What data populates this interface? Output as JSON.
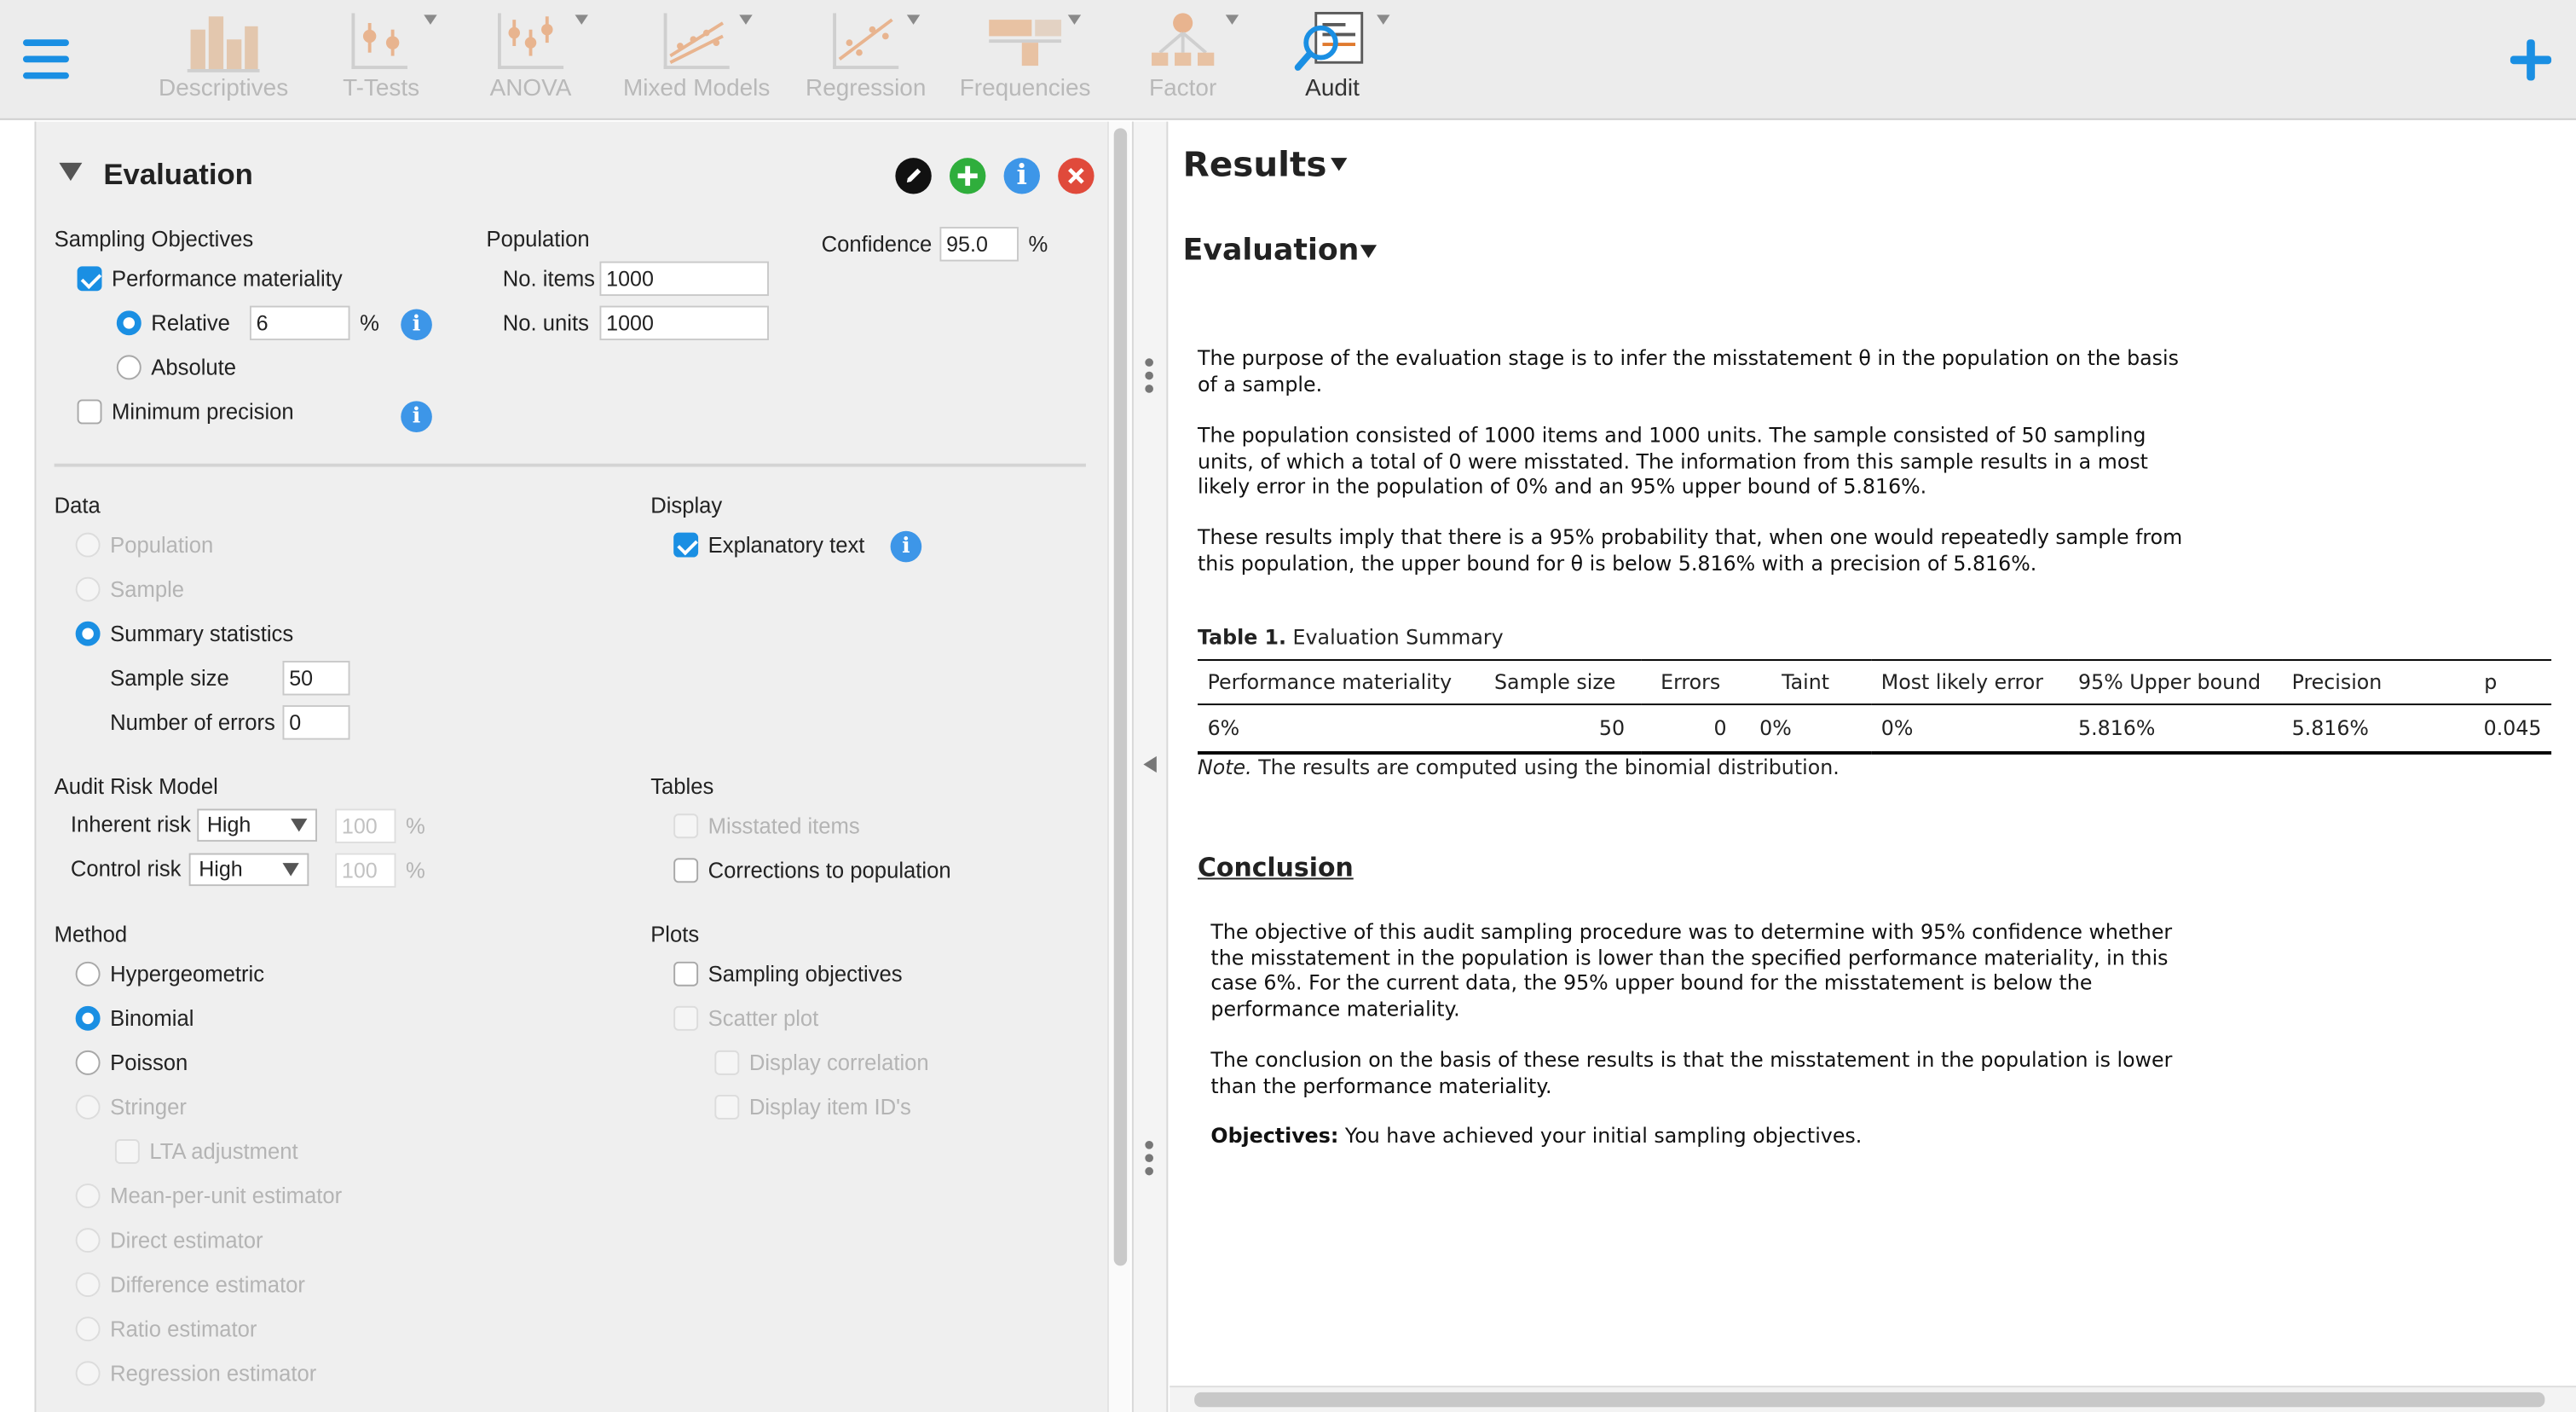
{
  "ribbon": {
    "items": [
      {
        "label": "Descriptives",
        "active": false
      },
      {
        "label": "T-Tests",
        "active": false
      },
      {
        "label": "ANOVA",
        "active": false
      },
      {
        "label": "Mixed Models",
        "active": false
      },
      {
        "label": "Regression",
        "active": false
      },
      {
        "label": "Frequencies",
        "active": false
      },
      {
        "label": "Factor",
        "active": false
      },
      {
        "label": "Audit",
        "active": true
      }
    ]
  },
  "panel": {
    "title": "Evaluation",
    "sampling_objectives": {
      "header": "Sampling Objectives",
      "performance_materiality": "Performance materiality",
      "relative": "Relative",
      "relative_value": "6",
      "percent": "%",
      "absolute": "Absolute",
      "minimum_precision": "Minimum precision"
    },
    "population": {
      "header": "Population",
      "items_label": "No. items",
      "items_value": "1000",
      "units_label": "No. units",
      "units_value": "1000"
    },
    "confidence": {
      "label": "Confidence",
      "value": "95.0",
      "percent": "%"
    },
    "data": {
      "header": "Data",
      "population": "Population",
      "sample": "Sample",
      "summary": "Summary statistics",
      "sample_size_label": "Sample size",
      "sample_size_value": "50",
      "errors_label": "Number of errors",
      "errors_value": "0"
    },
    "display": {
      "header": "Display",
      "explanatory": "Explanatory text"
    },
    "audit_risk": {
      "header": "Audit Risk Model",
      "inherent_label": "Inherent risk",
      "inherent_value": "High",
      "inherent_pct": "100",
      "control_label": "Control risk",
      "control_value": "High",
      "control_pct": "100",
      "percent": "%"
    },
    "tables": {
      "header": "Tables",
      "misstated": "Misstated items",
      "corrections": "Corrections to population"
    },
    "method": {
      "header": "Method",
      "hypergeometric": "Hypergeometric",
      "binomial": "Binomial",
      "poisson": "Poisson",
      "stringer": "Stringer",
      "lta": "LTA adjustment",
      "mpu": "Mean-per-unit estimator",
      "direct": "Direct estimator",
      "difference": "Difference estimator",
      "ratio": "Ratio estimator",
      "regression": "Regression estimator"
    },
    "plots": {
      "header": "Plots",
      "sampling_objectives": "Sampling objectives",
      "scatter": "Scatter plot",
      "correlation": "Display correlation",
      "item_ids": "Display item ID's"
    }
  },
  "results": {
    "title": "Results",
    "section": "Evaluation",
    "p1": "The purpose of the evaluation stage is to infer the misstatement θ in the population on the basis of a sample.",
    "p2": "The population consisted of 1000 items and 1000 units. The sample consisted of 50 sampling units, of which a total of 0 were misstated. The information from this sample results in a most likely error in the population of 0% and an 95% upper bound of 5.816%.",
    "p3": "These results imply that there is a 95% probability that, when one would repeatedly sample from this population, the upper bound for θ is below 5.816% with a precision of 5.816%.",
    "table_caption_bold": "Table 1.",
    "table_caption": " Evaluation Summary",
    "table": {
      "headers": [
        "Performance materiality",
        "Sample size",
        "Errors",
        "Taint",
        "Most likely error",
        "95% Upper bound",
        "Precision",
        "p"
      ],
      "row": [
        "6%",
        "50",
        "0",
        "0%",
        "0%",
        "5.816%",
        "5.816%",
        "0.045"
      ]
    },
    "note_label": "Note.",
    "note": " The results are computed using the binomial distribution.",
    "conclusion_title": "Conclusion",
    "c1": "The objective of this audit sampling procedure was to determine with 95% confidence whether the misstatement in the population is lower than the specified performance materiality, in this case 6%. For the current data, the 95% upper bound for the misstatement is below the performance materiality.",
    "c2": "The conclusion on the basis of these results is that the misstatement in the population is lower than the performance materiality.",
    "c3_label": "Objectives:",
    "c3": " You have achieved your initial sampling objectives."
  },
  "colors": {
    "accent": "#1a8fe3",
    "edit": "#111111",
    "add": "#2fae3c",
    "info": "#3d96e8",
    "close": "#e04a3b"
  }
}
